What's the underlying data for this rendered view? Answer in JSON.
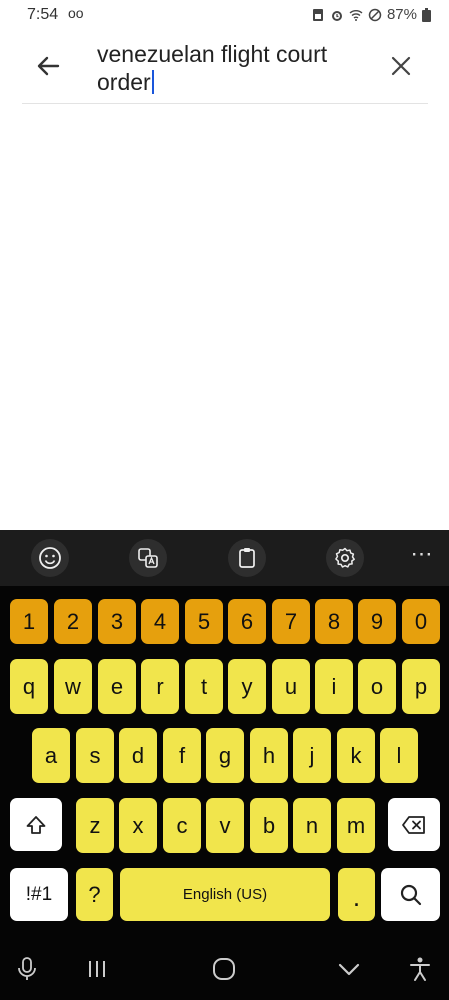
{
  "status_bar": {
    "time": "7:54",
    "voicemail_glyph": "oo",
    "battery": "87%",
    "icons": [
      "sim-icon",
      "alarm-icon",
      "wifi-icon",
      "dnd-icon",
      "battery-icon"
    ]
  },
  "search": {
    "query": "venezuelan flight court order",
    "back_icon": "arrow-left-icon",
    "clear_icon": "close-icon"
  },
  "keyboard": {
    "toolbar_icons": [
      "emoji-icon",
      "translate-icon",
      "clipboard-icon",
      "settings-icon",
      "more-icon"
    ],
    "number_row": [
      "1",
      "2",
      "3",
      "4",
      "5",
      "6",
      "7",
      "8",
      "9",
      "0"
    ],
    "row1": [
      "q",
      "w",
      "e",
      "r",
      "t",
      "y",
      "u",
      "i",
      "o",
      "p"
    ],
    "row2": [
      "a",
      "s",
      "d",
      "f",
      "g",
      "h",
      "j",
      "k",
      "l"
    ],
    "row3": [
      "z",
      "x",
      "c",
      "v",
      "b",
      "n",
      "m"
    ],
    "symbols_label": "!#1",
    "question_label": "?",
    "space_label": "English (US)",
    "period_label": ".",
    "colors": {
      "letter": "#f1e54c",
      "number": "#e6a00d",
      "background": "#050505",
      "special": "#ffffff"
    }
  },
  "nav_bar": {
    "icons": [
      "microphone-icon",
      "recent-apps-icon",
      "home-icon",
      "hide-keyboard-icon",
      "accessibility-icon"
    ]
  }
}
